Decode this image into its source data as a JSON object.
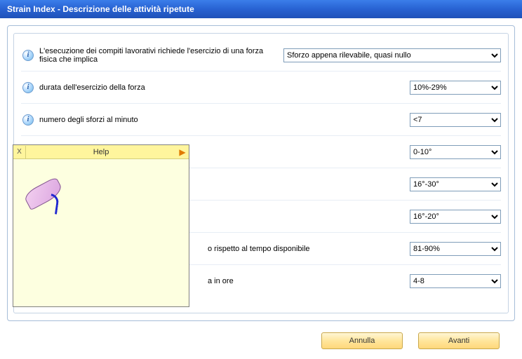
{
  "window": {
    "title": "Strain Index  -  Descrizione delle attività ripetute"
  },
  "rows": [
    {
      "label": "L'esecuzione dei compiti lavorativi richiede l'esercizio di una forza fisica che implica",
      "value": "Sforzo appena rilevabile, quasi nullo",
      "wide": true
    },
    {
      "label": "durata dell'esercizio della forza",
      "value": "10%-29%",
      "wide": false
    },
    {
      "label": "numero degli sforzi al minuto",
      "value": "<7",
      "wide": false
    },
    {
      "label": "",
      "value": "0-10°",
      "wide": false
    },
    {
      "label": "",
      "value": "16°-30°",
      "wide": false
    },
    {
      "label": "",
      "value": "16°-20°",
      "wide": false
    },
    {
      "label": "o rispetto al tempo disponibile",
      "value": "81-90%",
      "wide": false
    },
    {
      "label": "a in ore",
      "value": "4-8",
      "wide": false
    }
  ],
  "help": {
    "title": "Help",
    "close": "X",
    "arrow": "▶"
  },
  "buttons": {
    "cancel": "Annulla",
    "next": "Avanti"
  }
}
